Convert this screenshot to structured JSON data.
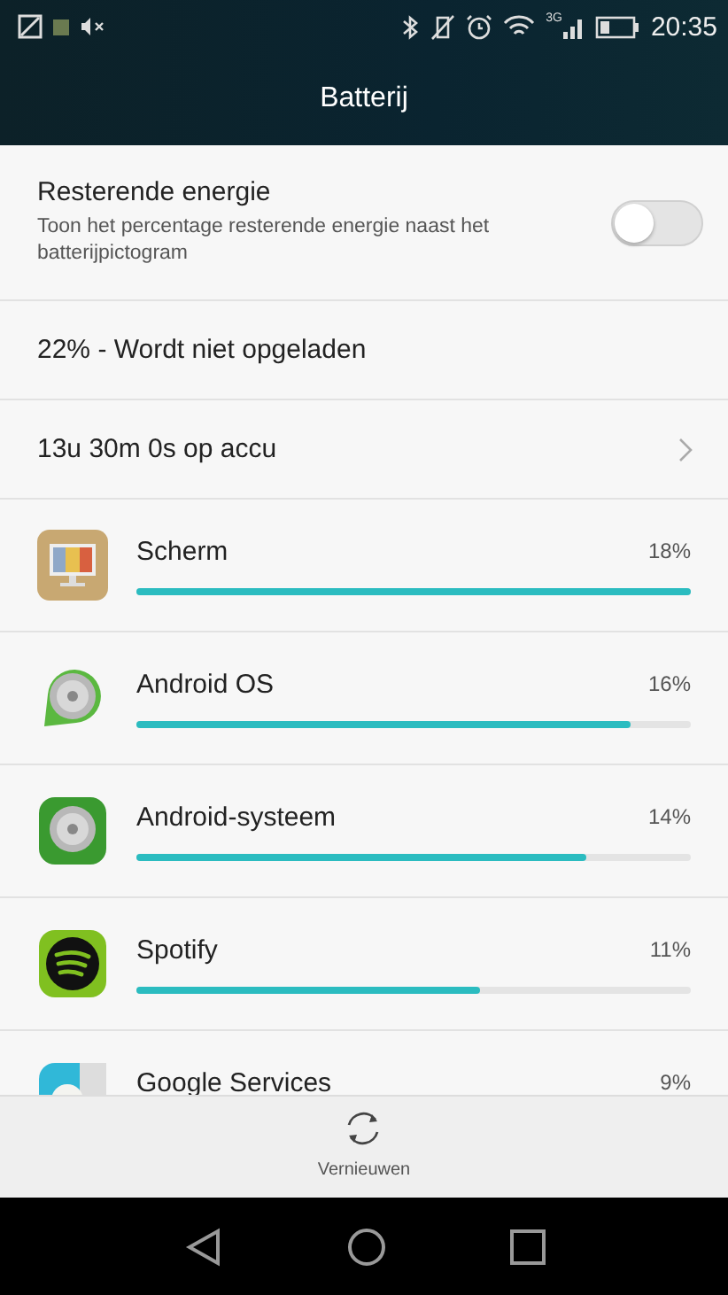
{
  "status_bar": {
    "time": "20:35",
    "network": "3G"
  },
  "title": "Batterij",
  "setting": {
    "title": "Resterende energie",
    "description": "Toon het percentage resterende energie naast het batterijpictogram",
    "on": false
  },
  "status": "22% - Wordt niet opgeladen",
  "runtime": "13u 30m 0s op accu",
  "apps": [
    {
      "name": "Scherm",
      "percent": "18%",
      "level": 1.0
    },
    {
      "name": "Android OS",
      "percent": "16%",
      "level": 0.89
    },
    {
      "name": "Android-systeem",
      "percent": "14%",
      "level": 0.81
    },
    {
      "name": "Spotify",
      "percent": "11%",
      "level": 0.62
    },
    {
      "name": "Google Services",
      "percent": "9%"
    }
  ],
  "refresh": {
    "label": "Vernieuwen"
  }
}
